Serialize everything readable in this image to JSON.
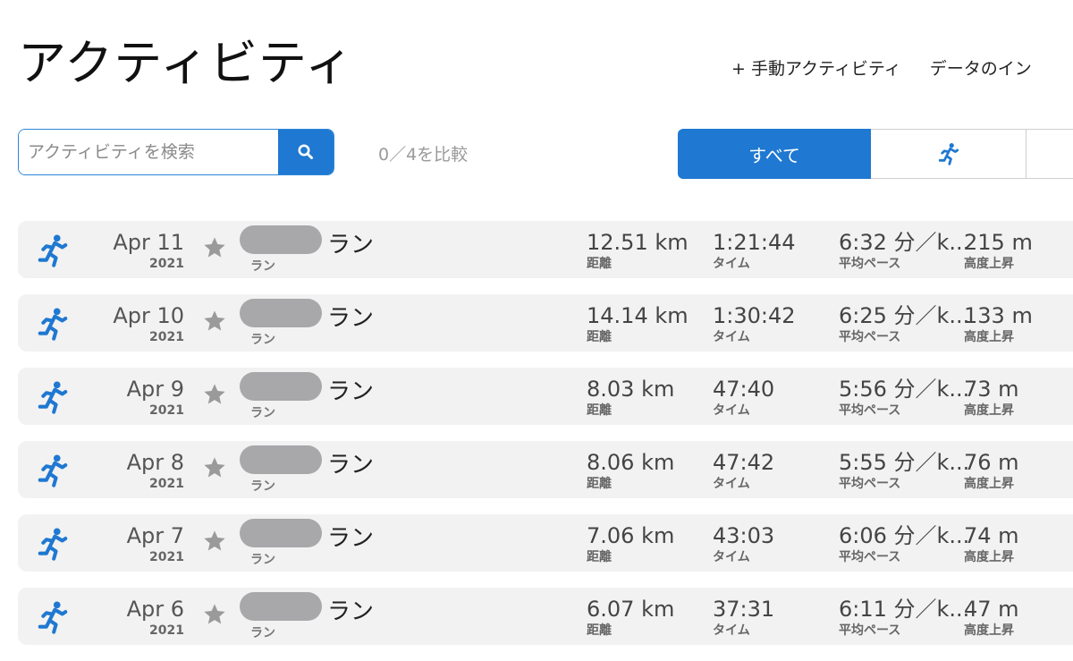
{
  "header": {
    "title": "アクティビティ",
    "manual_activity": "+ 手動アクティビティ",
    "import_data": "データのイン"
  },
  "search": {
    "placeholder": "アクティビティを検索",
    "icon": "search-icon"
  },
  "compare": "0／4を比較",
  "filters": {
    "all_label": "すべて",
    "run_icon": "running-icon"
  },
  "labels": {
    "distance": "距離",
    "time": "タイム",
    "pace": "平均ペース",
    "elevation": "高度上昇"
  },
  "colors": {
    "accent": "#1f78d1",
    "row_bg": "#f2f2f2",
    "star": "#9a9a9a"
  },
  "activities": [
    {
      "date": "Apr 11",
      "year": "2021",
      "name": "ラン",
      "type": "ラン",
      "distance": "12.51 km",
      "time": "1:21:44",
      "pace": "6:32 分／k...",
      "elevation": "215 m"
    },
    {
      "date": "Apr 10",
      "year": "2021",
      "name": "ラン",
      "type": "ラン",
      "distance": "14.14 km",
      "time": "1:30:42",
      "pace": "6:25 分／k...",
      "elevation": "133 m"
    },
    {
      "date": "Apr 9",
      "year": "2021",
      "name": "ラン",
      "type": "ラン",
      "distance": "8.03 km",
      "time": "47:40",
      "pace": "5:56 分／k...",
      "elevation": "73 m"
    },
    {
      "date": "Apr 8",
      "year": "2021",
      "name": "ラン",
      "type": "ラン",
      "distance": "8.06 km",
      "time": "47:42",
      "pace": "5:55 分／k...",
      "elevation": "76 m"
    },
    {
      "date": "Apr 7",
      "year": "2021",
      "name": "ラン",
      "type": "ラン",
      "distance": "7.06 km",
      "time": "43:03",
      "pace": "6:06 分／k...",
      "elevation": "74 m"
    },
    {
      "date": "Apr 6",
      "year": "2021",
      "name": "ラン",
      "type": "ラン",
      "distance": "6.07 km",
      "time": "37:31",
      "pace": "6:11 分／k...",
      "elevation": "47 m"
    }
  ]
}
